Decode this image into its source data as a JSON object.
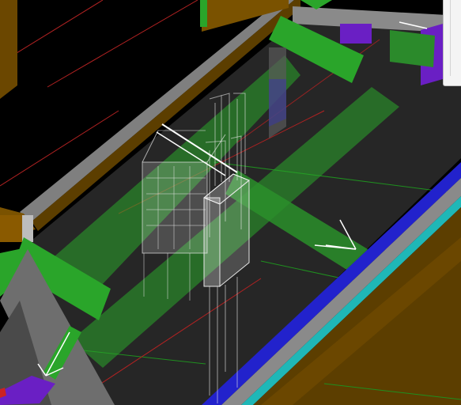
{
  "viewport": {
    "label": "",
    "background": "#000000",
    "colors": {
      "wall": "#5c3e00",
      "wall_face": "#7a5200",
      "beam_top": "#7f7f7f",
      "green_brace": "#2aa52a",
      "green_brace_dark": "#1d7f1d",
      "floor": "#262626",
      "blue_edge": "#2222cc",
      "cyan_edge": "#1fb7b7",
      "purple": "#6a1fc4",
      "grid_red": "#b22222",
      "grid_green": "#1f8f1f",
      "wireframe": "#e6e6e6"
    }
  },
  "tools_panel": {
    "label": ""
  }
}
